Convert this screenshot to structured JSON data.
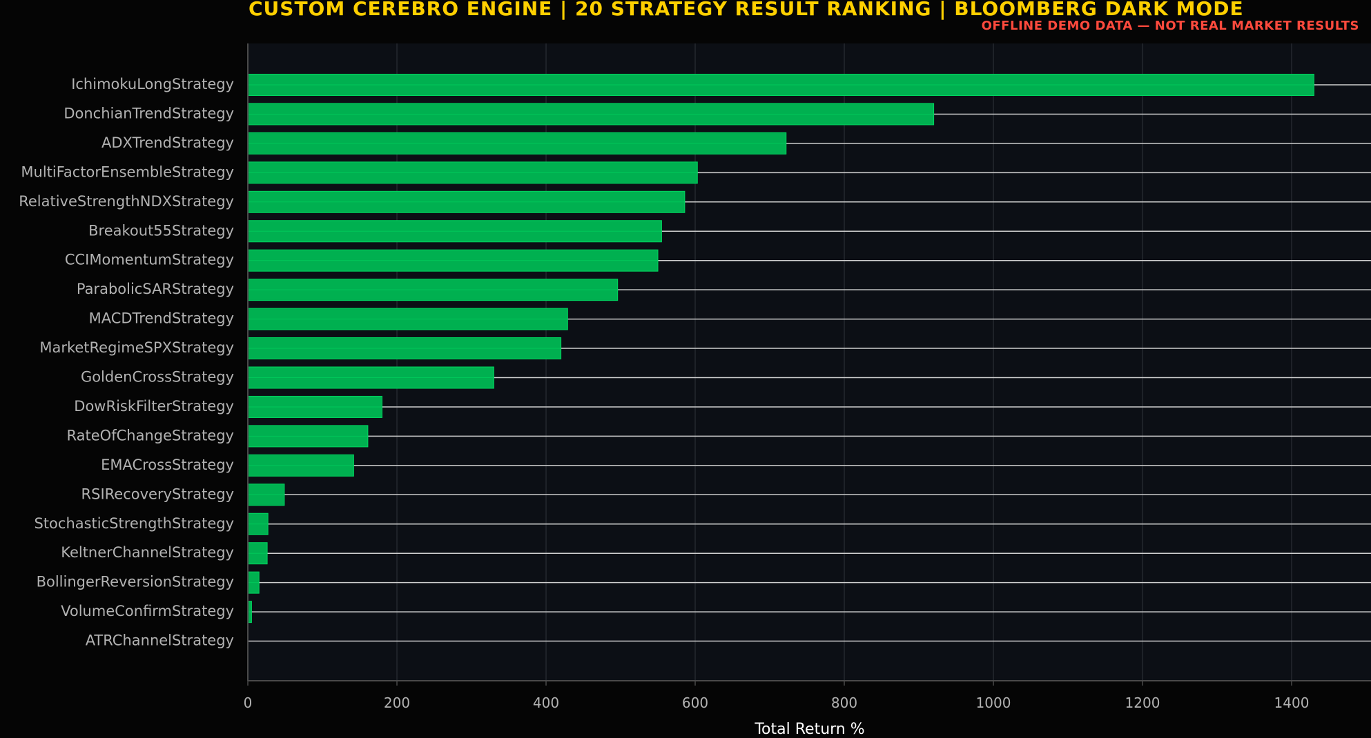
{
  "colors": {
    "page_background": "#050505",
    "plot_background": "#0c0f15",
    "bar_fill": "#00b050",
    "bar_edge": "#00d760",
    "title": "#ffd000",
    "subtitle": "#ff4a3d",
    "label_text": "#b2b2b2",
    "axis_title_text": "#ffffff",
    "axis_line": "#4a4a4a",
    "grid_line": "#2a2e35",
    "connector_line": "#d0d0d0"
  },
  "chart_data": {
    "type": "bar",
    "orientation": "horizontal",
    "title": "CUSTOM CEREBRO ENGINE | 20 STRATEGY RESULT RANKING | BLOOMBERG DARK MODE",
    "subtitle": "OFFLINE DEMO DATA — NOT REAL MARKET RESULTS",
    "xlabel": "Total Return %",
    "ylabel": "",
    "xlim": [
      0,
      1500
    ],
    "xticks": [
      0,
      200,
      400,
      600,
      800,
      1000,
      1200,
      1400
    ],
    "grid": true,
    "categories": [
      "IchimokuLongStrategy",
      "DonchianTrendStrategy",
      "ADXTrendStrategy",
      "MultiFactorEnsembleStrategy",
      "RelativeStrengthNDXStrategy",
      "Breakout55Strategy",
      "CCIMomentumStrategy",
      "ParabolicSARStrategy",
      "MACDTrendStrategy",
      "MarketRegimeSPXStrategy",
      "GoldenCrossStrategy",
      "DowRiskFilterStrategy",
      "RateOfChangeStrategy",
      "EMACrossStrategy",
      "RSIRecoveryStrategy",
      "StochasticStrengthStrategy",
      "KeltnerChannelStrategy",
      "BollingerReversionStrategy",
      "VolumeConfirmStrategy",
      "ATRChannelStrategy"
    ],
    "values": [
      1430,
      920,
      722,
      603,
      586,
      555,
      550,
      496,
      429,
      420,
      330,
      180,
      161,
      142,
      49,
      27,
      26,
      15,
      5,
      0
    ]
  }
}
